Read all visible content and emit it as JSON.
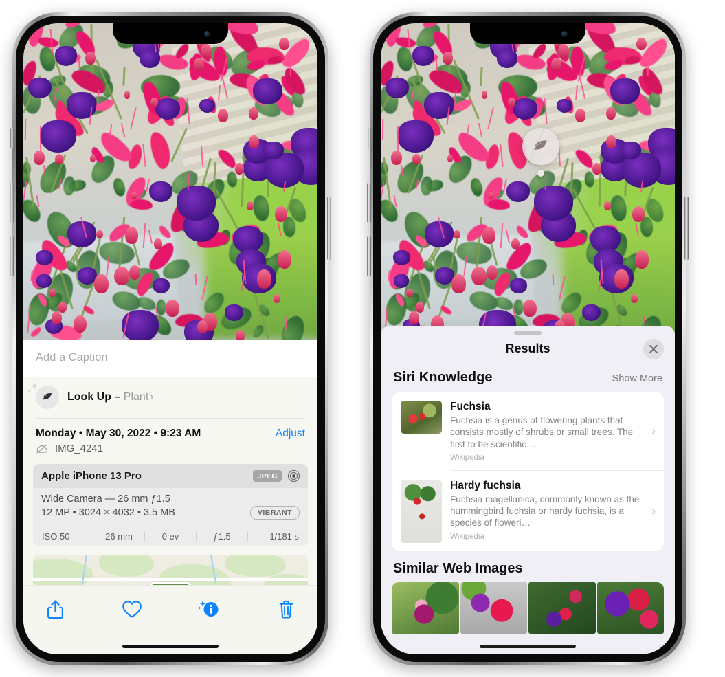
{
  "left_phone": {
    "caption": {
      "placeholder": "Add a Caption",
      "value": ""
    },
    "look_up": {
      "label": "Look Up",
      "dash": " – ",
      "subject": "Plant",
      "chevron": "›",
      "icon": "leaf-icon"
    },
    "info": {
      "date_line": "Monday • May 30, 2022 • 9:23 AM",
      "adjust_label": "Adjust",
      "filename": "IMG_4241",
      "cloud_icon": "icloud-slash-icon"
    },
    "exif": {
      "device": "Apple iPhone 13 Pro",
      "format_badge": "JPEG",
      "lens_icon": "lens-icon",
      "lens_line": "Wide Camera — 26 mm ƒ1.5",
      "spec_line": "12 MP • 3024 × 4032 • 3.5 MB",
      "style_badge": "VIBRANT",
      "stats": [
        "ISO 50",
        "26 mm",
        "0 ev",
        "ƒ1.5",
        "1/181 s"
      ]
    },
    "toolbar": [
      {
        "name": "share-button",
        "icon": "share-icon"
      },
      {
        "name": "favorite-button",
        "icon": "heart-icon"
      },
      {
        "name": "info-button",
        "icon": "info-sparkle-icon"
      },
      {
        "name": "delete-button",
        "icon": "trash-icon"
      }
    ]
  },
  "right_phone": {
    "lookup_badge": {
      "icon": "leaf-icon"
    },
    "sheet": {
      "title": "Results",
      "close_icon": "close-icon",
      "grabber": "drag-handle"
    },
    "siri_knowledge": {
      "title": "Siri Knowledge",
      "show_more": "Show More",
      "items": [
        {
          "title": "Fuchsia",
          "description": "Fuchsia is a genus of flowering plants that consists mostly of shrubs or small trees. The first to be scientific…",
          "source": "Wikipedia",
          "chevron": "›"
        },
        {
          "title": "Hardy fuchsia",
          "description": "Fuchsia magellanica, commonly known as the hummingbird fuchsia or hardy fuchsia, is a species of floweri…",
          "source": "Wikipedia",
          "chevron": "›"
        }
      ]
    },
    "similar_web_images": {
      "title": "Similar Web Images",
      "thumbnails": [
        "web-image-1",
        "web-image-2",
        "web-image-3",
        "web-image-4"
      ]
    }
  },
  "colors": {
    "accent_blue": "#0a84ff",
    "sheet_bg": "#f0eff5",
    "card_bg": "#ffffff",
    "secondary_text": "#85858b",
    "page_bg": "#ffffff"
  }
}
